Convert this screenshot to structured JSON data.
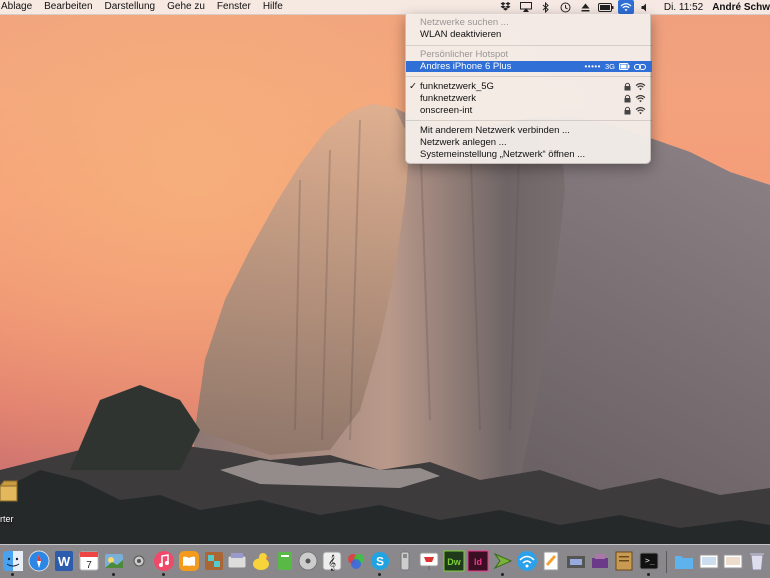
{
  "menubar": {
    "items": [
      "Ablage",
      "Bearbeiten",
      "Darstellung",
      "Gehe zu",
      "Fenster",
      "Hilfe"
    ],
    "clock": "Di. 11:52",
    "user": "André Schw"
  },
  "status_icons": [
    "dropbox-icon",
    "airplay-icon",
    "bluetooth-icon",
    "time-machine-icon",
    "eject-icon",
    "battery-icon",
    "wifi-icon",
    "volume-icon"
  ],
  "wifi_menu": {
    "searching": "Netzwerke suchen ...",
    "toggle": "WLAN deaktivieren",
    "hotspot_header": "Persönlicher Hotspot",
    "hotspot": {
      "name": "Andres iPhone 6 Plus",
      "signal": "•••••",
      "network_type": "3G"
    },
    "networks": [
      {
        "name": "funknetzwerk_5G",
        "connected": true,
        "locked": true
      },
      {
        "name": "funknetzwerk",
        "connected": false,
        "locked": true
      },
      {
        "name": "onscreen-int",
        "connected": false,
        "locked": true
      }
    ],
    "actions": [
      "Mit anderem Netzwerk verbinden ...",
      "Netzwerk anlegen ...",
      "Systemeinstellung „Netzwerk“ öffnen ..."
    ]
  },
  "desktop": {
    "item_label": "rter"
  },
  "dock": {
    "apps": [
      "finder-icon",
      "safari-icon",
      "preview-icon",
      "word-icon",
      "calendar-icon",
      "iphoto-icon",
      "system-preferences-icon",
      "itunes-icon",
      "ibooks-icon",
      "photo-booth-icon",
      "image-capture-icon",
      "cyberduck-icon",
      "evernote-icon",
      "dvd-player-icon",
      "sibelius-icon",
      "colorsync-icon",
      "skype-icon",
      "usb-icon",
      "keynote-icon",
      "dreamweaver-icon",
      "indesign-icon",
      "textwrangler-icon",
      "wifi-diagnostics-icon",
      "pages-icon",
      "migration-icon",
      "hardware-icon",
      "notefile-icon",
      "terminal-icon",
      "downloads-folder-icon",
      "documents-stack-icon",
      "screenshots-stack-icon",
      "trash-icon"
    ]
  }
}
